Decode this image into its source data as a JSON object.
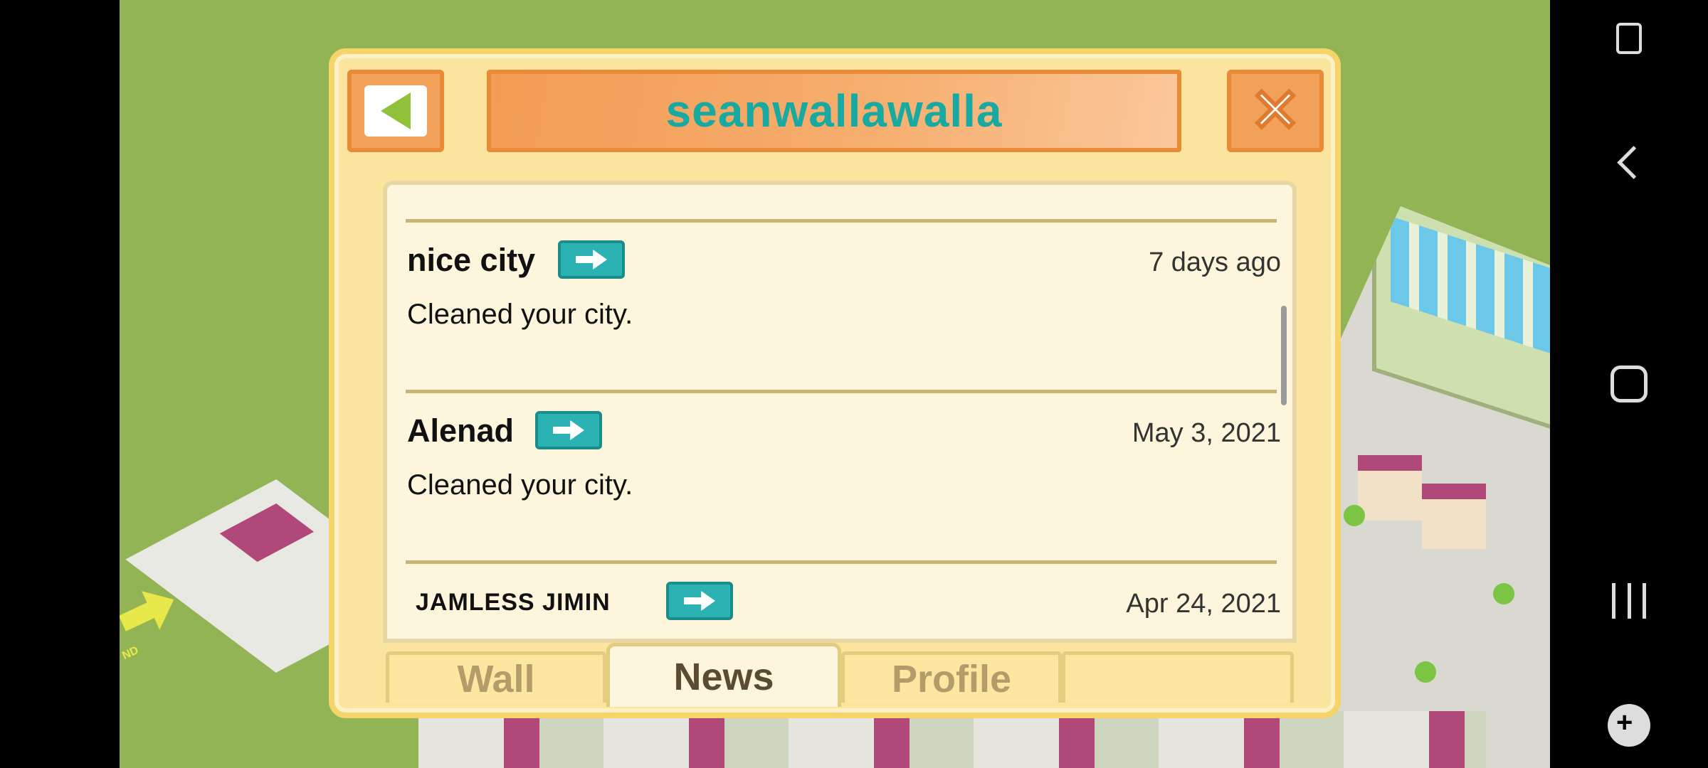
{
  "dialog": {
    "title": "seanwallawalla"
  },
  "feed": {
    "entries": [
      {
        "name": "nice city",
        "date": "7 days ago",
        "message": "Cleaned your city."
      },
      {
        "name": "Alenad",
        "date": "May 3, 2021",
        "message": "Cleaned your city."
      },
      {
        "name": "JAMLESS JIMIN",
        "date": "Apr 24, 2021",
        "message": ""
      }
    ]
  },
  "tabs": {
    "wall": "Wall",
    "news": "News",
    "profile": "Profile",
    "active": "News"
  },
  "colors": {
    "title": "#17a9a2",
    "accent_orange": "#f2a15a",
    "go_button": "#2bb2b2",
    "panel": "#fbe49e"
  },
  "icons": {
    "back": "back-arrow-icon",
    "close": "close-icon",
    "go": "arrow-right-icon"
  },
  "land_label": "ND"
}
